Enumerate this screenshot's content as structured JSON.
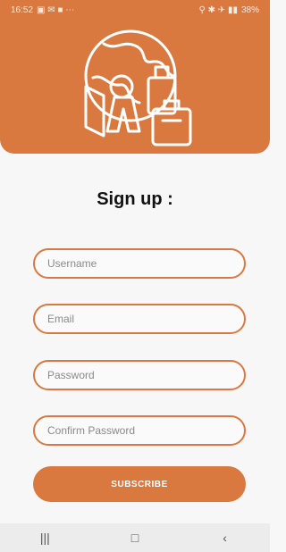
{
  "status_bar": {
    "time": "16:52",
    "battery": "38%"
  },
  "hero": {
    "icon": "travel-globe-luggage-icon"
  },
  "form": {
    "title": "Sign up :",
    "username_placeholder": "Username",
    "email_placeholder": "Email",
    "password_placeholder": "Password",
    "confirm_password_placeholder": "Confirm Password",
    "submit_label": "SUBSCRIBE"
  },
  "nav": {
    "recents_icon": "recents-icon",
    "home_icon": "home-icon",
    "back_icon": "back-icon"
  },
  "colors": {
    "accent": "#d9793f",
    "background": "#f7f7f7"
  }
}
